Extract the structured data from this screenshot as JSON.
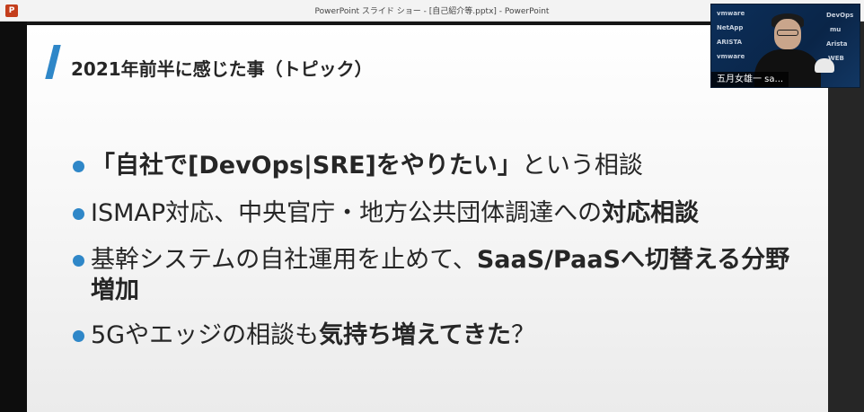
{
  "window": {
    "title": "PowerPoint スライド ショー - [自己紹介等.pptx] - PowerPoint",
    "app_icon_letter": "P"
  },
  "slide": {
    "title": "2021年前半に感じた事（トピック）",
    "accent_color": "#2f87c8",
    "bullets": [
      {
        "parts": [
          {
            "text": "「自社で[DevOps|SRE]をやりたい」",
            "bold": true
          },
          {
            "text": "という相談",
            "bold": false
          }
        ]
      },
      {
        "parts": [
          {
            "text": "ISMAP対応、中央官庁・地方公共団体調達への",
            "bold": false
          },
          {
            "text": "対応相談",
            "bold": true
          }
        ]
      },
      {
        "parts": [
          {
            "text": "基幹システムの自社運用を止めて、",
            "bold": false
          },
          {
            "text": "SaaS/PaaSへ切替える分野増加",
            "bold": true
          }
        ]
      },
      {
        "parts": [
          {
            "text": "5Gやエッジの相談も",
            "bold": false
          },
          {
            "text": "気持ち増えてきた",
            "bold": true
          },
          {
            "text": "？",
            "bold": false
          }
        ]
      }
    ]
  },
  "webcam": {
    "name_tag": "五月女雄一 sa...",
    "sponsor_logos": [
      "vmware",
      "NetApp",
      "ARISTA",
      "vmware",
      "DevOps",
      "mu",
      "Arista",
      "WEB"
    ]
  }
}
